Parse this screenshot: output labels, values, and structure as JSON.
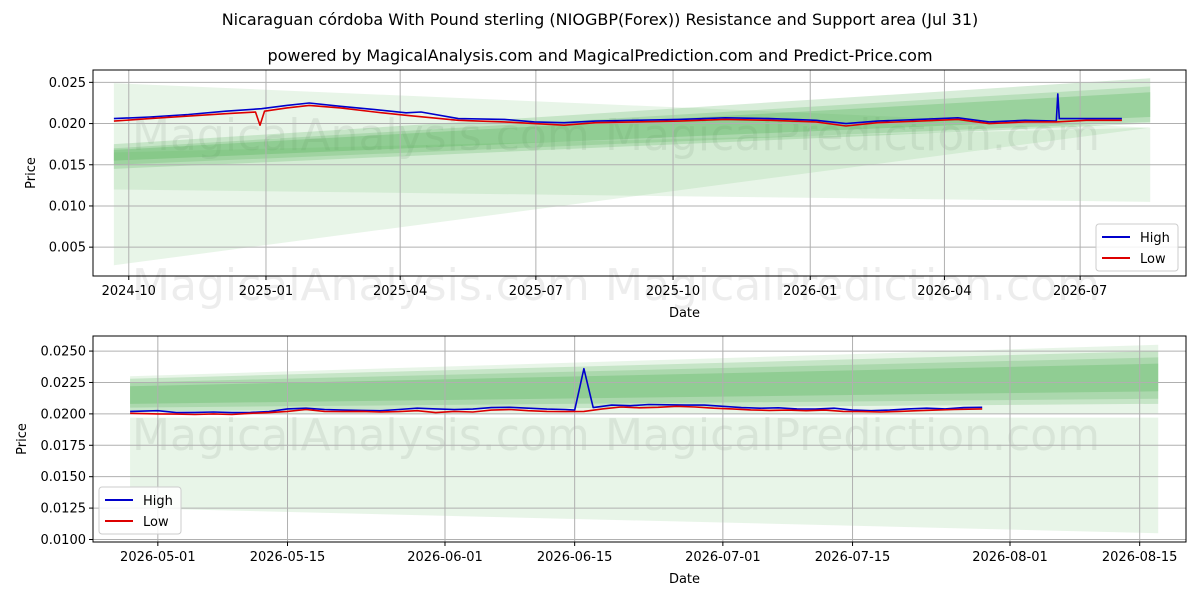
{
  "title": "Nicaraguan córdoba With Pound sterling (NIOGBP(Forex)) Resistance and Support area (Jul 31)",
  "subtitle": "powered by MagicalAnalysis.com and MagicalPrediction.com and Predict-Price.com",
  "watermarks": [
    "MagicalAnalysis.com",
    "MagicalPrediction.com"
  ],
  "colors": {
    "high": "#0000cc",
    "low": "#dd0000",
    "band": "#4caf50",
    "grid": "#b0b0b0"
  },
  "chart_data": [
    {
      "type": "line",
      "xlabel": "Date",
      "ylabel": "Price",
      "xlim": [
        "2024-09-07",
        "2026-09-10"
      ],
      "ylim": [
        0.0015,
        0.0265
      ],
      "x_ticks": [
        "2024-10",
        "2025-01",
        "2025-04",
        "2025-07",
        "2025-10",
        "2026-01",
        "2026-04",
        "2026-07"
      ],
      "y_ticks": [
        "0.005",
        "0.010",
        "0.015",
        "0.020",
        "0.025"
      ],
      "y_tick_values": [
        0.005,
        0.01,
        0.015,
        0.02,
        0.025
      ],
      "grid": true,
      "legend": {
        "position": "lower-right",
        "entries": [
          "High",
          "Low"
        ]
      },
      "series": [
        {
          "name": "High",
          "x": [
            "2024-09-21",
            "2024-10-15",
            "2024-11-10",
            "2024-12-05",
            "2024-12-29",
            "2025-01-15",
            "2025-01-30",
            "2025-02-20",
            "2025-03-15",
            "2025-04-05",
            "2025-04-15",
            "2025-05-10",
            "2025-06-10",
            "2025-06-30",
            "2025-07-20",
            "2025-08-10",
            "2025-09-05",
            "2025-10-05",
            "2025-11-05",
            "2025-12-05",
            "2026-01-05",
            "2026-01-25",
            "2026-02-15",
            "2026-03-15",
            "2026-04-10",
            "2026-05-01",
            "2026-05-25",
            "2026-06-15",
            "2026-06-16",
            "2026-06-17",
            "2026-07-05",
            "2026-07-29"
          ],
          "values": [
            0.0206,
            0.0208,
            0.0211,
            0.0215,
            0.0218,
            0.0222,
            0.0225,
            0.0221,
            0.0217,
            0.0213,
            0.0214,
            0.0206,
            0.0205,
            0.0202,
            0.0201,
            0.0203,
            0.0204,
            0.0205,
            0.0207,
            0.0206,
            0.0204,
            0.02,
            0.0203,
            0.0205,
            0.0207,
            0.0202,
            0.0204,
            0.0203,
            0.0236,
            0.0206,
            0.0206,
            0.0206
          ]
        },
        {
          "name": "Low",
          "x": [
            "2024-09-21",
            "2024-10-15",
            "2024-11-10",
            "2024-12-05",
            "2024-12-25",
            "2024-12-28",
            "2024-12-31",
            "2025-01-15",
            "2025-01-30",
            "2025-02-20",
            "2025-03-15",
            "2025-04-05",
            "2025-05-10",
            "2025-06-10",
            "2025-06-30",
            "2025-07-20",
            "2025-08-10",
            "2025-09-05",
            "2025-10-05",
            "2025-11-05",
            "2025-12-05",
            "2026-01-05",
            "2026-01-25",
            "2026-02-15",
            "2026-03-15",
            "2026-04-10",
            "2026-05-01",
            "2026-05-25",
            "2026-06-15",
            "2026-07-05",
            "2026-07-29"
          ],
          "values": [
            0.0203,
            0.0206,
            0.0209,
            0.0212,
            0.0214,
            0.0198,
            0.0215,
            0.0219,
            0.0222,
            0.0219,
            0.0214,
            0.021,
            0.0204,
            0.0202,
            0.02,
            0.0198,
            0.0201,
            0.0202,
            0.0203,
            0.0205,
            0.0204,
            0.0202,
            0.0197,
            0.0201,
            0.0203,
            0.0205,
            0.02,
            0.0202,
            0.0202,
            0.0204,
            0.0204
          ]
        }
      ],
      "bands": [
        {
          "x": [
            "2024-09-21",
            "2026-08-17"
          ],
          "lower": [
            0.0028,
            0.0195
          ],
          "upper": [
            0.0249,
            0.0195
          ]
        },
        {
          "x": [
            "2024-09-21",
            "2026-08-17"
          ],
          "lower": [
            0.012,
            0.0105
          ],
          "upper": [
            0.0165,
            0.0195
          ]
        },
        {
          "x": [
            "2024-09-21",
            "2026-08-17"
          ],
          "lower": [
            0.0145,
            0.02
          ],
          "upper": [
            0.0175,
            0.0255
          ]
        },
        {
          "x": [
            "2024-09-21",
            "2026-08-17"
          ],
          "lower": [
            0.015,
            0.0202
          ],
          "upper": [
            0.017,
            0.0245
          ]
        },
        {
          "x": [
            "2024-09-21",
            "2026-08-17"
          ],
          "lower": [
            0.0155,
            0.0208
          ],
          "upper": [
            0.0168,
            0.0238
          ]
        }
      ]
    },
    {
      "type": "line",
      "xlabel": "Date",
      "ylabel": "Price",
      "xlim": [
        "2026-04-24",
        "2026-08-20"
      ],
      "ylim": [
        0.0098,
        0.0262
      ],
      "x_ticks": [
        "2026-05-01",
        "2026-05-15",
        "2026-06-01",
        "2026-06-15",
        "2026-07-01",
        "2026-07-15",
        "2026-08-01",
        "2026-08-15"
      ],
      "y_ticks": [
        "0.0100",
        "0.0125",
        "0.0150",
        "0.0175",
        "0.0200",
        "0.0225",
        "0.0250"
      ],
      "y_tick_values": [
        0.01,
        0.0125,
        0.015,
        0.0175,
        0.02,
        0.0225,
        0.025
      ],
      "grid": true,
      "legend": {
        "position": "lower-left",
        "entries": [
          "High",
          "Low"
        ]
      },
      "series": [
        {
          "name": "High",
          "x": [
            "2026-04-28",
            "2026-05-01",
            "2026-05-03",
            "2026-05-05",
            "2026-05-07",
            "2026-05-09",
            "2026-05-11",
            "2026-05-13",
            "2026-05-15",
            "2026-05-17",
            "2026-05-19",
            "2026-05-21",
            "2026-05-23",
            "2026-05-25",
            "2026-05-27",
            "2026-05-29",
            "2026-05-31",
            "2026-06-02",
            "2026-06-04",
            "2026-06-06",
            "2026-06-08",
            "2026-06-10",
            "2026-06-12",
            "2026-06-14",
            "2026-06-15",
            "2026-06-16",
            "2026-06-17",
            "2026-06-19",
            "2026-06-21",
            "2026-06-23",
            "2026-06-25",
            "2026-06-27",
            "2026-06-29",
            "2026-07-01",
            "2026-07-03",
            "2026-07-05",
            "2026-07-07",
            "2026-07-09",
            "2026-07-11",
            "2026-07-13",
            "2026-07-15",
            "2026-07-17",
            "2026-07-19",
            "2026-07-21",
            "2026-07-23",
            "2026-07-25",
            "2026-07-27",
            "2026-07-29"
          ],
          "values": [
            0.0202,
            0.02025,
            0.0201,
            0.02012,
            0.02015,
            0.0201,
            0.02012,
            0.02018,
            0.0204,
            0.02045,
            0.02035,
            0.0203,
            0.02028,
            0.02025,
            0.02035,
            0.02045,
            0.0204,
            0.02035,
            0.02038,
            0.0205,
            0.02052,
            0.02045,
            0.02038,
            0.02035,
            0.0203,
            0.0236,
            0.0205,
            0.0207,
            0.02065,
            0.02075,
            0.02072,
            0.0207,
            0.0207,
            0.0206,
            0.0205,
            0.02045,
            0.02048,
            0.0204,
            0.02038,
            0.02045,
            0.0203,
            0.02025,
            0.0203,
            0.0204,
            0.02045,
            0.0204,
            0.0205,
            0.02052
          ]
        },
        {
          "name": "Low",
          "x": [
            "2026-04-28",
            "2026-05-01",
            "2026-05-03",
            "2026-05-05",
            "2026-05-07",
            "2026-05-09",
            "2026-05-11",
            "2026-05-13",
            "2026-05-15",
            "2026-05-17",
            "2026-05-19",
            "2026-05-21",
            "2026-05-23",
            "2026-05-25",
            "2026-05-27",
            "2026-05-29",
            "2026-05-31",
            "2026-06-02",
            "2026-06-04",
            "2026-06-06",
            "2026-06-08",
            "2026-06-10",
            "2026-06-12",
            "2026-06-14",
            "2026-06-16",
            "2026-06-18",
            "2026-06-20",
            "2026-06-22",
            "2026-06-24",
            "2026-06-26",
            "2026-06-28",
            "2026-06-30",
            "2026-07-02",
            "2026-07-04",
            "2026-07-06",
            "2026-07-08",
            "2026-07-10",
            "2026-07-12",
            "2026-07-14",
            "2026-07-16",
            "2026-07-18",
            "2026-07-20",
            "2026-07-22",
            "2026-07-24",
            "2026-07-26",
            "2026-07-29"
          ],
          "values": [
            0.02005,
            0.02,
            0.01998,
            0.01995,
            0.02,
            0.01995,
            0.02005,
            0.0201,
            0.0202,
            0.02035,
            0.0202,
            0.02018,
            0.0202,
            0.02015,
            0.02018,
            0.02025,
            0.0201,
            0.0202,
            0.02015,
            0.0203,
            0.02035,
            0.02025,
            0.0202,
            0.02018,
            0.0202,
            0.0204,
            0.02055,
            0.02048,
            0.02052,
            0.0206,
            0.02055,
            0.02045,
            0.0204,
            0.02032,
            0.02028,
            0.0203,
            0.02025,
            0.0203,
            0.0202,
            0.02018,
            0.02015,
            0.0202,
            0.02025,
            0.0203,
            0.02035,
            0.0204
          ]
        }
      ],
      "bands": [
        {
          "x": [
            "2026-04-28",
            "2026-08-17"
          ],
          "lower": [
            0.0125,
            0.0105
          ],
          "upper": [
            0.0197,
            0.0197
          ]
        },
        {
          "x": [
            "2026-04-28",
            "2026-08-17"
          ],
          "lower": [
            0.02,
            0.02
          ],
          "upper": [
            0.023,
            0.0255
          ]
        },
        {
          "x": [
            "2026-04-28",
            "2026-08-17"
          ],
          "lower": [
            0.0202,
            0.0208
          ],
          "upper": [
            0.0228,
            0.025
          ]
        },
        {
          "x": [
            "2026-04-28",
            "2026-08-17"
          ],
          "lower": [
            0.0205,
            0.0212
          ],
          "upper": [
            0.0225,
            0.0245
          ]
        },
        {
          "x": [
            "2026-04-28",
            "2026-08-17"
          ],
          "lower": [
            0.0208,
            0.0218
          ],
          "upper": [
            0.0222,
            0.024
          ]
        }
      ]
    }
  ]
}
